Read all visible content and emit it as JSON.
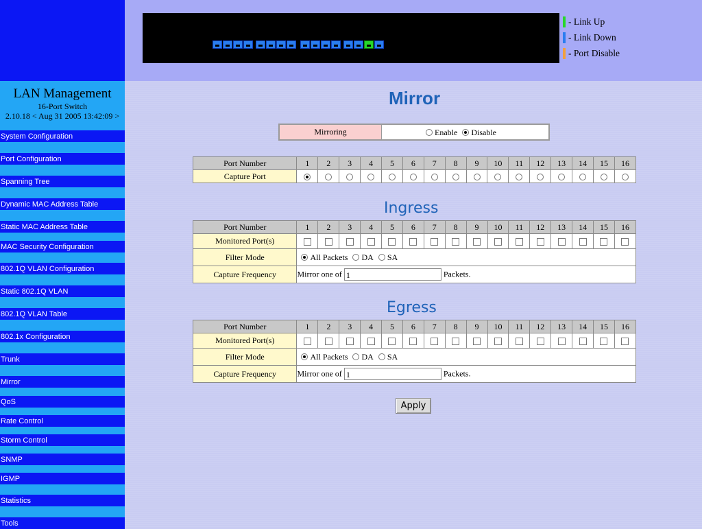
{
  "brand": {
    "title": "LAN Management",
    "subtitle": "16-Port Switch",
    "version": "2.10.18 < Aug 31 2005 13:42:09 >"
  },
  "nav": [
    "System Configuration",
    "Port Configuration",
    "Spanning Tree",
    "Dynamic MAC Address Table",
    "Static MAC Address Table",
    "MAC Security Configuration",
    "802.1Q VLAN Configuration",
    "Static 802.1Q VLAN",
    "802.1Q VLAN Table",
    "802.1x Configuration",
    "Trunk",
    "Mirror",
    "QoS",
    "Rate Control",
    "Storm Control",
    "SNMP",
    "IGMP",
    "Statistics",
    "Tools"
  ],
  "legend": {
    "link_up": "- Link Up",
    "link_down": "- Link Down",
    "port_disable": "- Port Disable"
  },
  "colors": {
    "link_up": "#27d72a",
    "link_down": "#2a7df0",
    "port_disable": "#f0a040",
    "title_blue": "#1f63b8"
  },
  "ports": {
    "count": 16,
    "up": [
      15
    ]
  },
  "page": {
    "title": "Mirror"
  },
  "mirroring": {
    "label": "Mirroring",
    "enable": "Enable",
    "disable": "Disable",
    "selected": "disable"
  },
  "capture": {
    "header": "Port Number",
    "label": "Capture Port",
    "selected": 1
  },
  "port_numbers": [
    "1",
    "2",
    "3",
    "4",
    "5",
    "6",
    "7",
    "8",
    "9",
    "10",
    "11",
    "12",
    "13",
    "14",
    "15",
    "16"
  ],
  "ingress": {
    "title": "Ingress",
    "header": "Port Number",
    "monitored_label": "Monitored Port(s)",
    "filter_label": "Filter Mode",
    "filter_all": "All Packets",
    "filter_da": "DA",
    "filter_sa": "SA",
    "filter_selected": "all",
    "freq_label": "Capture Frequency",
    "freq_prefix": "Mirror one of",
    "freq_value": "1",
    "freq_suffix": "Packets."
  },
  "egress": {
    "title": "Egress",
    "header": "Port Number",
    "monitored_label": "Monitored Port(s)",
    "filter_label": "Filter Mode",
    "filter_all": "All Packets",
    "filter_da": "DA",
    "filter_sa": "SA",
    "filter_selected": "all",
    "freq_label": "Capture Frequency",
    "freq_prefix": "Mirror one of",
    "freq_value": "1",
    "freq_suffix": "Packets."
  },
  "apply_label": "Apply"
}
